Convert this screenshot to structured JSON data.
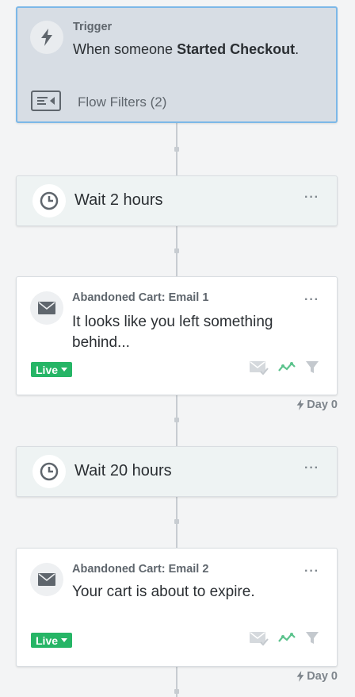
{
  "trigger": {
    "label": "Trigger",
    "prefix": "When someone",
    "event": "Started Checkout",
    "suffix": ".",
    "filters": "Flow Filters (2)"
  },
  "wait1": {
    "label": "Wait 2 hours",
    "more": "···"
  },
  "email1": {
    "title": "Abandoned Cart: Email 1",
    "subject": "It looks like you left something behind...",
    "status": "Live",
    "more": "···",
    "day": "Day 0"
  },
  "wait2": {
    "label": "Wait 20 hours",
    "more": "···"
  },
  "email2": {
    "title": "Abandoned Cart: Email 2",
    "subject": "Your cart is about to expire.",
    "status": "Live",
    "more": "···",
    "day": "Day 0"
  },
  "colors": {
    "accent": "#7cb8e8",
    "live": "#26b566",
    "wait_bg": "#eef3f3",
    "trigger_bg": "#d7dde4"
  }
}
